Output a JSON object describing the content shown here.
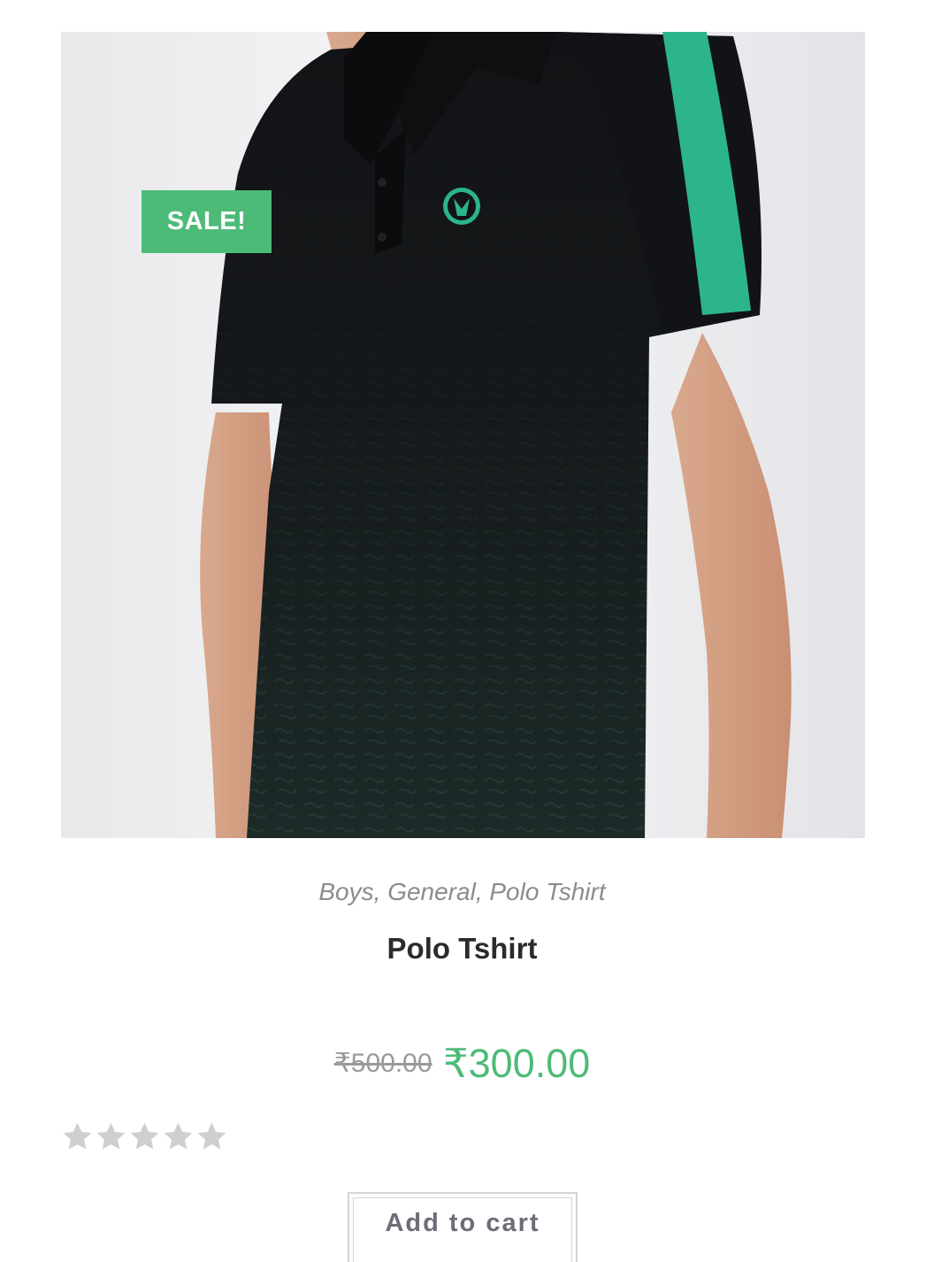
{
  "product": {
    "badge": "SALE!",
    "categories": [
      "Boys",
      "General",
      "Polo Tshirt"
    ],
    "category_separator": ",",
    "title": "Polo Tshirt",
    "price_old": "₹500.00",
    "price_new": "₹300.00",
    "rating": 0,
    "rating_max": 5,
    "add_to_cart_label": "Add to cart"
  },
  "colors": {
    "accent": "#4dbb78",
    "shirt": "#121316",
    "stripe": "#2cb58c",
    "star_empty": "#cfcfcf"
  },
  "icons": {
    "star": "star-icon",
    "logo": "brand-logo-icon"
  }
}
